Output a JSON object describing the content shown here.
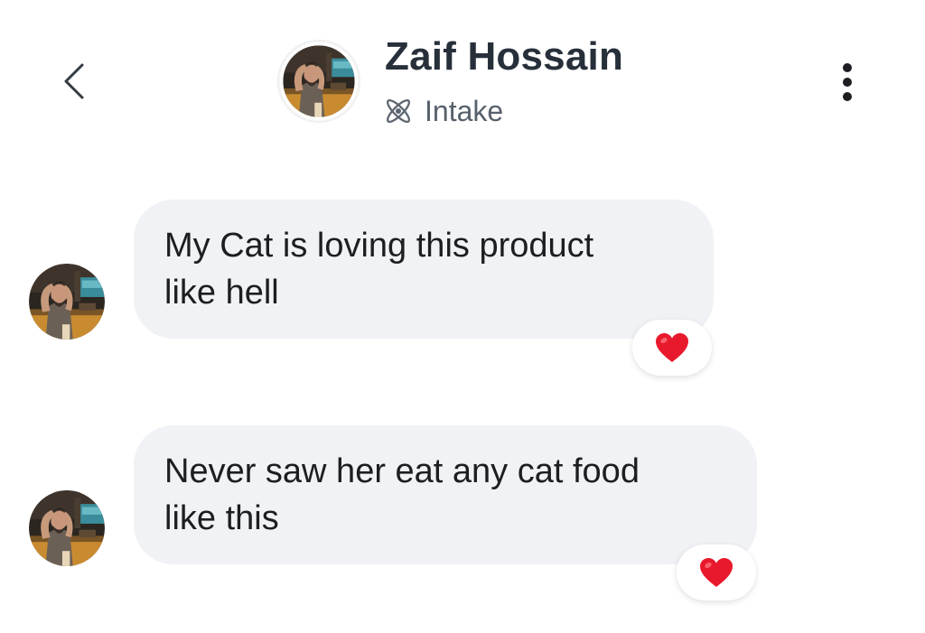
{
  "header": {
    "contact_name": "Zaif Hossain",
    "subtitle": "Intake",
    "subtitle_icon": "messenger-atom-icon"
  },
  "messages": [
    {
      "lines": [
        "My Cat is loving this product",
        "like hell"
      ],
      "reaction": "❤️",
      "reaction_icon": "heart-icon"
    },
    {
      "lines": [
        "Never saw her eat any cat food",
        "like this"
      ],
      "reaction": "❤️",
      "reaction_icon": "heart-icon"
    }
  ],
  "colors": {
    "bubble": "#f0f2f5",
    "heart": "#e8192c",
    "name_text": "#27303a",
    "subtitle_text": "#57616b"
  }
}
